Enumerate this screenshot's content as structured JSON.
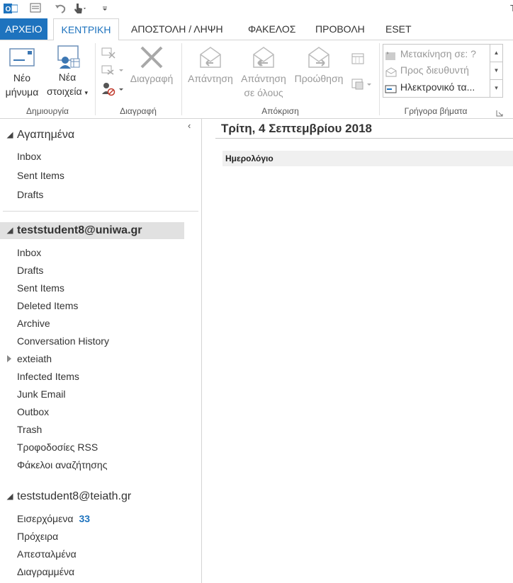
{
  "window": {
    "title_fragment": "Τ"
  },
  "ribbon_tabs": [
    {
      "label": "ΑΡΧΕΙΟ"
    },
    {
      "label": "ΚΕΝΤΡΙΚΗ"
    },
    {
      "label": "ΑΠΟΣΤΟΛΗ / ΛΗΨΗ"
    },
    {
      "label": "ΦΑΚΕΛΟΣ"
    },
    {
      "label": "ΠΡΟΒΟΛΗ"
    },
    {
      "label": "ESET"
    }
  ],
  "ribbon": {
    "new_email": {
      "line1": "Νέο",
      "line2": "μήνυμα"
    },
    "new_items": {
      "line1": "Νέα",
      "line2": "στοιχεία"
    },
    "delete": "Διαγραφή",
    "reply": "Απάντηση",
    "reply_all": {
      "line1": "Απάντηση",
      "line2": "σε όλους"
    },
    "forward": "Προώθηση",
    "quick_steps": [
      {
        "label": "Μετακίνηση σε: ?"
      },
      {
        "label": "Προς διευθυντή"
      },
      {
        "label": "Ηλεκτρονικό τα..."
      }
    ],
    "groups": {
      "create": "Δημιουργία",
      "delete": "Διαγραφή",
      "respond": "Απόκριση",
      "quick_steps": "Γρήγορα βήματα"
    }
  },
  "nav": {
    "favorites": {
      "header": "Αγαπημένα",
      "items": [
        "Inbox",
        "Sent Items",
        "Drafts"
      ]
    },
    "account1": {
      "header": "teststudent8@uniwa.gr",
      "items": [
        "Inbox",
        "Drafts",
        "Sent Items",
        "Deleted Items",
        "Archive",
        "Conversation History",
        "exteiath",
        "Infected Items",
        "Junk Email",
        "Outbox",
        "Trash",
        "Τροφοδοσίες RSS",
        "Φάκελοι αναζήτησης"
      ]
    },
    "account2": {
      "header": "teststudent8@teiath.gr",
      "items": [
        {
          "label": "Εισερχόμενα",
          "count": "33"
        },
        {
          "label": "Πρόχειρα",
          "count": ""
        },
        {
          "label": "Απεσταλμένα",
          "count": ""
        },
        {
          "label": "Διαγραμμένα",
          "count": ""
        }
      ]
    }
  },
  "main": {
    "date_title": "Τρίτη, 4 Σεπτεμβρίου 2018",
    "calendar_label": "Ημερολόγιο"
  },
  "colors": {
    "accent": "#1e73be",
    "selected_bg": "#e1e1e1"
  }
}
